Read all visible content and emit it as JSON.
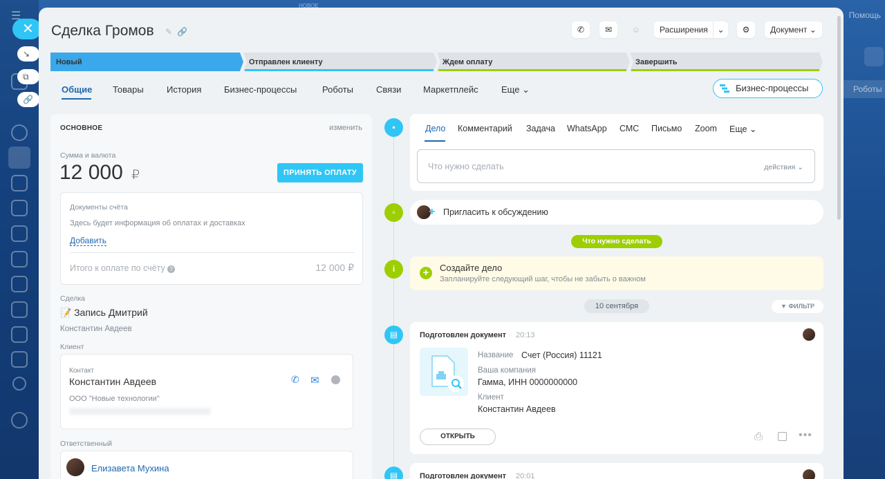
{
  "background": {
    "help_label": "Помощь",
    "robots_label": "Роботы",
    "mini_label": "НОВОЕ"
  },
  "deal": {
    "title": "Сделка Громов"
  },
  "header_buttons": {
    "extensions": "Расширения",
    "document": "Документ"
  },
  "stages": [
    {
      "label": "Новый",
      "active": true
    },
    {
      "label": "Отправлен клиенту",
      "active": false
    },
    {
      "label": "Ждем оплату",
      "active": false
    },
    {
      "label": "Завершить",
      "active": false
    }
  ],
  "tabs": [
    "Общие",
    "Товары",
    "История",
    "Бизнес-процессы",
    "Роботы",
    "Связи",
    "Маркетплейс",
    "Еще"
  ],
  "bp_button": "Бизнес-процессы",
  "main": {
    "section_title": "ОСНОВНОЕ",
    "edit_link": "изменить",
    "amount_label": "Сумма и валюта",
    "amount_value": "12 000",
    "currency": "₽",
    "pay_button": "ПРИНЯТЬ ОПЛАТУ",
    "invoice_docs_label": "Документы счёта",
    "invoice_docs_info": "Здесь будет информация об оплатах и доставках",
    "add_link": "Добавить",
    "invoice_total_label": "Итого к оплате по счёту",
    "invoice_total_value": "12 000 ₽",
    "deal_label": "Сделка",
    "deal_record": "Запись Дмитрий",
    "deal_person": "Константин Авдеев",
    "client_label": "Клиент",
    "contact_label": "Контакт",
    "contact_name": "Константин Авдеев",
    "company": "ООО \"Новые технологии\"",
    "responsible_label": "Ответственный",
    "responsible_name": "Елизавета Мухина"
  },
  "activity": {
    "tabs": [
      "Дело",
      "Комментарий",
      "Задача",
      "WhatsApp",
      "СМС",
      "Письмо",
      "Zoom",
      "Еще"
    ],
    "input_placeholder": "Что нужно сделать",
    "actions_label": "действия",
    "invite_label": "Пригласить к обсуждению",
    "todo_pill": "Что нужно сделать",
    "create_title": "Создайте дело",
    "create_subtitle": "Запланируйте следующий шаг, чтобы не забыть о важном",
    "date_pill": "10 сентября",
    "filter_label": "ФИЛЬТР"
  },
  "timeline": [
    {
      "title": "Подготовлен документ",
      "time": "20:13",
      "name_label": "Название",
      "name_value": "Счет (Россия) 11121",
      "company_label": "Ваша компания",
      "company_value": "Гамма, ИНН 0000000000",
      "client_label": "Клиент",
      "client_value": "Константин Авдеев",
      "open_button": "ОТКРЫТЬ"
    },
    {
      "title": "Подготовлен документ",
      "time": "20:01"
    }
  ]
}
